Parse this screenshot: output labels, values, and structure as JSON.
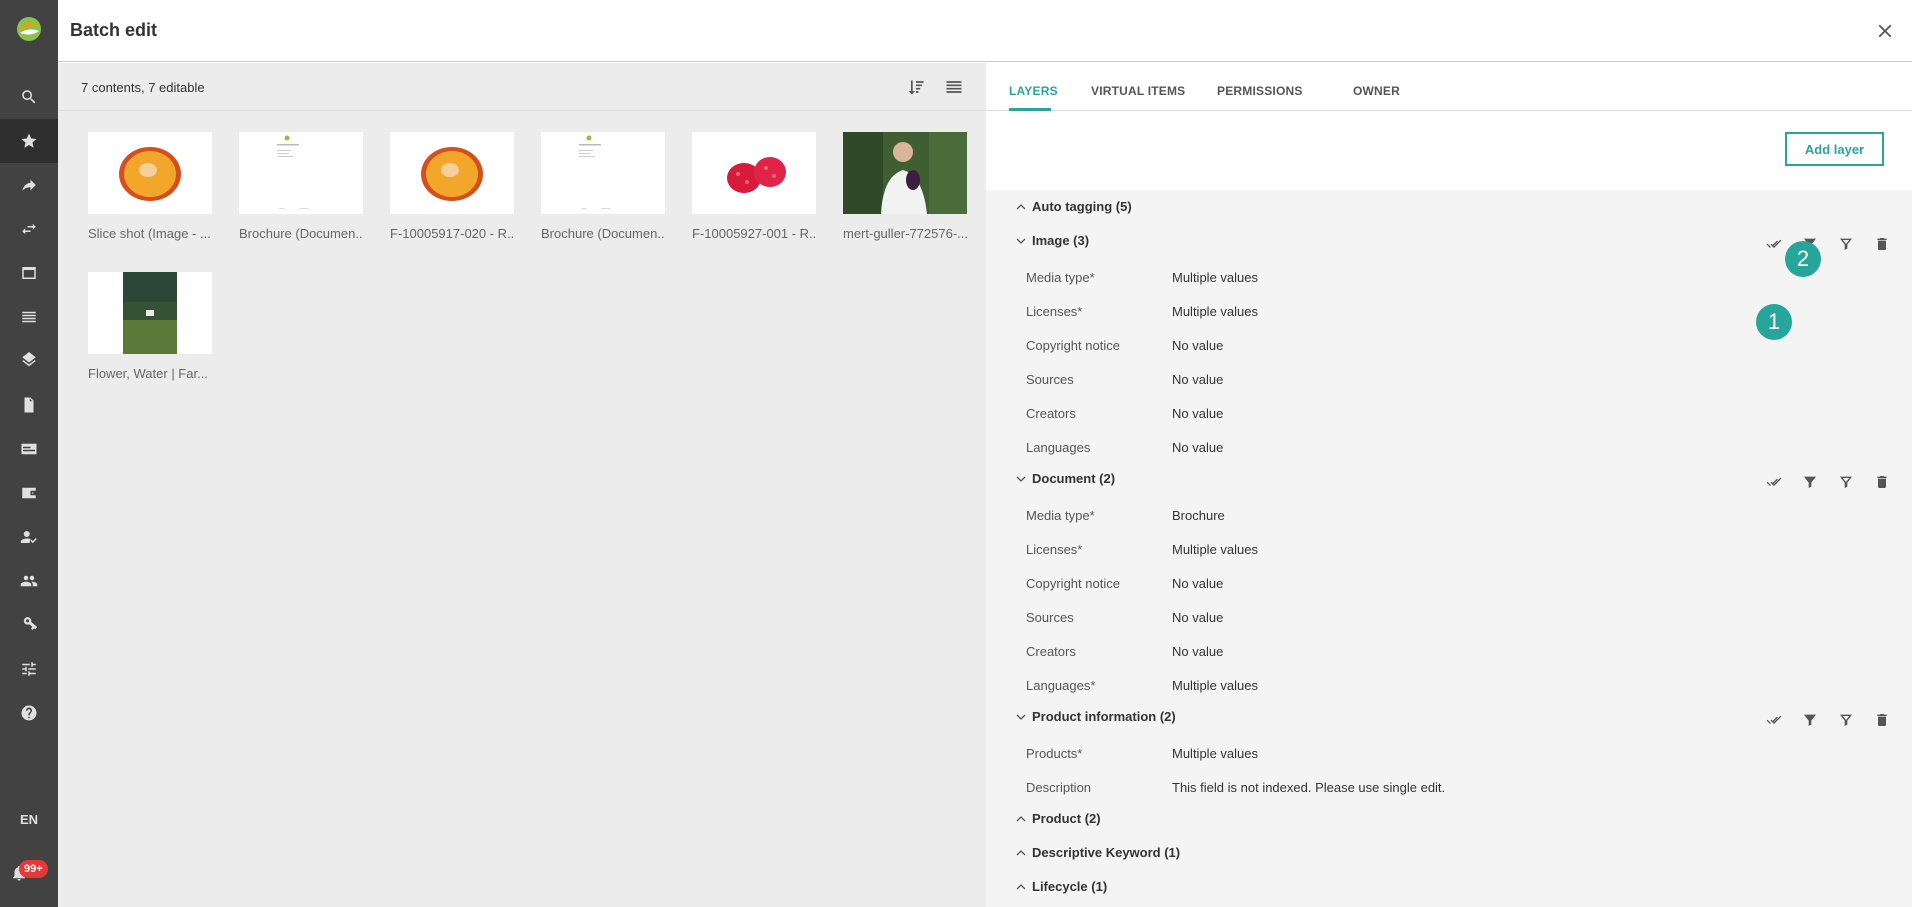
{
  "header": {
    "title": "Batch edit"
  },
  "nav": {
    "items": [
      "search-icon",
      "star-icon",
      "share-icon",
      "swap-icon",
      "window-icon",
      "list-icon",
      "layers-icon",
      "document-icon",
      "card-icon",
      "wallet-icon",
      "person-check-icon",
      "group-icon",
      "key-icon",
      "sliders-icon",
      "help-icon"
    ],
    "lang": "EN",
    "badge": "99+"
  },
  "content": {
    "count": "7 contents, 7 editable",
    "items": [
      {
        "label": "Slice shot (Image - ..."
      },
      {
        "label": "Brochure (Documen..."
      },
      {
        "label": "F-10005917-020 - R..."
      },
      {
        "label": "Brochure (Documen..."
      },
      {
        "label": "F-10005927-001 - R..."
      },
      {
        "label": "mert-guller-772576-..."
      },
      {
        "label": "Flower, Water | Far..."
      }
    ]
  },
  "panel": {
    "tabs": [
      "LAYERS",
      "VIRTUAL ITEMS",
      "PERMISSIONS",
      "OWNER"
    ],
    "add_layer": "Add layer",
    "sections": {
      "auto": "Auto tagging (5)",
      "image": "Image (3)",
      "document": "Document (2)",
      "product_info": "Product information (2)",
      "product": "Product (2)",
      "keyword": "Descriptive Keyword (1)",
      "lifecycle": "Lifecycle (1)"
    },
    "image_fields": [
      {
        "label": "Media type*",
        "value": "Multiple values"
      },
      {
        "label": "Licenses*",
        "value": "Multiple values"
      },
      {
        "label": "Copyright notice",
        "value": "No value"
      },
      {
        "label": "Sources",
        "value": "No value"
      },
      {
        "label": "Creators",
        "value": "No value"
      },
      {
        "label": "Languages",
        "value": "No value"
      }
    ],
    "document_fields": [
      {
        "label": "Media type*",
        "value": "Brochure"
      },
      {
        "label": "Licenses*",
        "value": "Multiple values"
      },
      {
        "label": "Copyright notice",
        "value": "No value"
      },
      {
        "label": "Sources",
        "value": "No value"
      },
      {
        "label": "Creators",
        "value": "No value"
      },
      {
        "label": "Languages*",
        "value": "Multiple values"
      }
    ],
    "product_info_fields": [
      {
        "label": "Products*",
        "value": "Multiple values"
      },
      {
        "label": "Description",
        "value": "This field is not indexed. Please use single edit."
      }
    ],
    "markers": [
      "1",
      "2"
    ]
  },
  "colors": {
    "accent": "#26a69a",
    "nav_bg": "#424242",
    "badge": "#e53935"
  }
}
